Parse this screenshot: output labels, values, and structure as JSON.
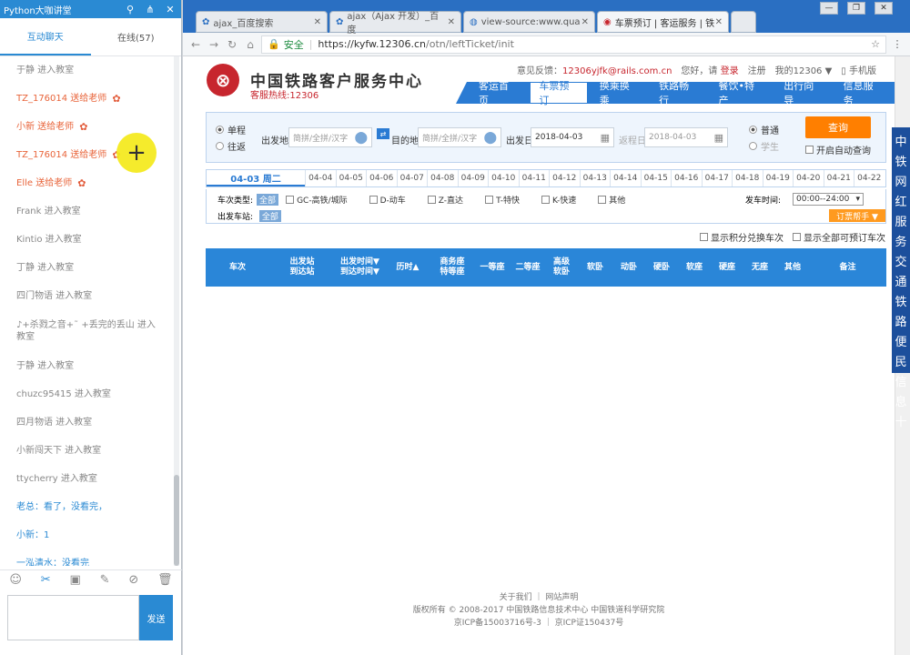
{
  "chat": {
    "title": "Python大咖讲堂",
    "tabs": [
      "互动聊天",
      "在线(57)"
    ],
    "messages": [
      {
        "text": "于静 进入教室",
        "style": ""
      },
      {
        "text": "TZ_176014 送给老师",
        "style": "hl",
        "flower": true
      },
      {
        "text": "小新 送给老师",
        "style": "hl",
        "flower": true
      },
      {
        "text": "TZ_176014 送给老师",
        "style": "hl",
        "flower": true
      },
      {
        "text": "Elle 送给老师",
        "style": "hl",
        "flower": true
      },
      {
        "text": "Frank 进入教室",
        "style": ""
      },
      {
        "text": "Kintio 进入教室",
        "style": ""
      },
      {
        "text": "丁静 进入教室",
        "style": ""
      },
      {
        "text": "四门物语 进入教室",
        "style": ""
      },
      {
        "text": "♪+杀戮之音+˜ +丢完的丢山 进入教室",
        "style": "two"
      },
      {
        "text": "于静 进入教室",
        "style": ""
      },
      {
        "text": "chuzc95415 进入教室",
        "style": ""
      },
      {
        "text": "四月物语 进入教室",
        "style": ""
      },
      {
        "text": "小新闯天下 进入教室",
        "style": ""
      },
      {
        "text": "ttycherry 进入教室",
        "style": ""
      },
      {
        "text": "老总：看了，没看完，",
        "style": "bl"
      },
      {
        "text": "小新：1",
        "style": "bl"
      },
      {
        "text": "一泓清水：没看完",
        "style": "bl"
      }
    ],
    "send_label": "发送",
    "toolbar_icons": [
      "smile-icon",
      "scissors-icon",
      "image-icon",
      "edit-icon",
      "forbid-icon",
      "trash-icon"
    ]
  },
  "browser": {
    "tabs": [
      {
        "title": "ajax_百度搜索",
        "favicon": "paw-icon"
      },
      {
        "title": "ajax（Ajax 开发）_百度",
        "favicon": "paw-icon"
      },
      {
        "title": "view-source:www.qua",
        "favicon": "globe-icon"
      },
      {
        "title": "车票预订 | 客运服务 | 铁",
        "favicon": "rail-icon",
        "active": true
      }
    ],
    "url": {
      "secure_label": "安全",
      "host": "https://kyfw.12306.cn",
      "path": "/otn/leftTicket/init"
    }
  },
  "site": {
    "name": "中国铁路客户服务中心",
    "hotline": "客服热线:12306",
    "complaint_label": "意见反馈：",
    "complaint_email": "12306yjfk@rails.com.cn",
    "greeting": "您好，请",
    "login": "登录",
    "register": "注册",
    "my12306": "我的12306 ▼",
    "mobile": "手机版",
    "nav": [
      "客运首页",
      "车票预订",
      "换乘换乘",
      "铁路畅行",
      "餐饮•特产",
      "出行向导",
      "信息服务"
    ],
    "nav_active": 1
  },
  "search": {
    "trip_single": "单程",
    "trip_round": "往返",
    "from_label": "出发地",
    "from_placeholder": "简拼/全拼/汉字",
    "to_label": "目的地",
    "to_placeholder": "简拼/全拼/汉字",
    "date_label": "出发日",
    "date_value": "2018-04-03",
    "return_label": "返程日",
    "return_value": "2018-04-03",
    "type_normal": "普通",
    "type_student": "学生",
    "query_label": "查询",
    "auto_query": "开启自动查询"
  },
  "dates": {
    "first": "04-03 周二",
    "days": [
      "04-04",
      "04-05",
      "04-06",
      "04-07",
      "04-08",
      "04-09",
      "04-10",
      "04-11",
      "04-12",
      "04-13",
      "04-14",
      "04-15",
      "04-16",
      "04-17",
      "04-18",
      "04-19",
      "04-20",
      "04-21",
      "04-22"
    ]
  },
  "filters": {
    "train_type_label": "车次类型:",
    "all_label": "全部",
    "types": [
      "GC-高铁/城际",
      "D-动车",
      "Z-直达",
      "T-特快",
      "K-快速",
      "其他"
    ],
    "depart_time_label": "发车时间:",
    "depart_time_value": "00:00--24:00",
    "from_station_label": "出发车站:",
    "sort_label": "订票帮手 ▼"
  },
  "options": [
    "显示积分兑换车次",
    "显示全部可预订车次"
  ],
  "table_headers": [
    "车次",
    "出发站\n到达站",
    "出发时间▼\n到达时间▼",
    "历时▲",
    "商务座\n特等座",
    "一等座",
    "二等座",
    "高级\n软卧",
    "软卧",
    "动卧",
    "硬卧",
    "软座",
    "硬座",
    "无座",
    "其他",
    "备注"
  ],
  "footer": {
    "links": "关于我们 ｜ 网站声明",
    "copyright": "版权所有 © 2008-2017 中国铁路信息技术中心 中国铁道科学研究院",
    "icp": "京ICP备15003716号-3 ｜ 京ICP证150437号"
  },
  "watermark": "80< 快剪辑",
  "sidebar_text": "中铁网红服务交通铁路便民信息十"
}
